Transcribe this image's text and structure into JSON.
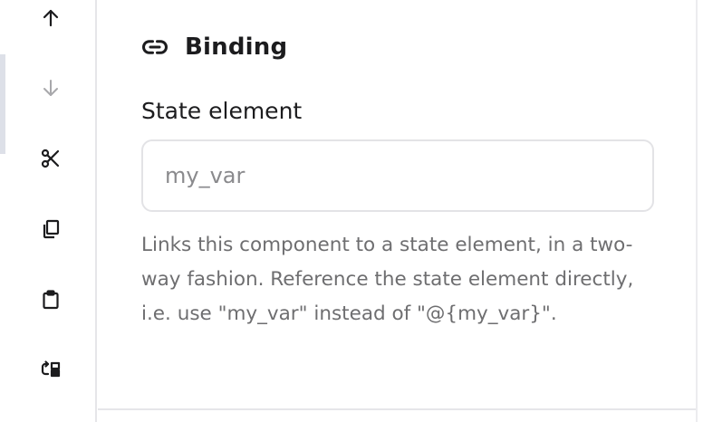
{
  "toolbar": {
    "items": [
      {
        "icon": "arrow-up-icon",
        "label": "Move up"
      },
      {
        "icon": "arrow-down-icon",
        "label": "Move down"
      },
      {
        "icon": "scissors-icon",
        "label": "Cut"
      },
      {
        "icon": "copy-icon",
        "label": "Copy"
      },
      {
        "icon": "clipboard-icon",
        "label": "Paste"
      },
      {
        "icon": "go-to-parent-icon",
        "label": "Go to parent"
      }
    ]
  },
  "binding": {
    "title": "Binding",
    "icon": "link-icon",
    "state_element": {
      "label": "State element",
      "value": "",
      "placeholder": "my_var"
    },
    "help_text": "Links this component to a state element, in a two-way fashion. Reference the state element directly, i.e. use \"my_var\" instead of \"@{my_var}\"."
  },
  "colors": {
    "text_primary": "#1c1c1e",
    "text_secondary": "#6e6e70",
    "disabled_icon": "#a8a8ab",
    "border": "#e3e3e6"
  }
}
